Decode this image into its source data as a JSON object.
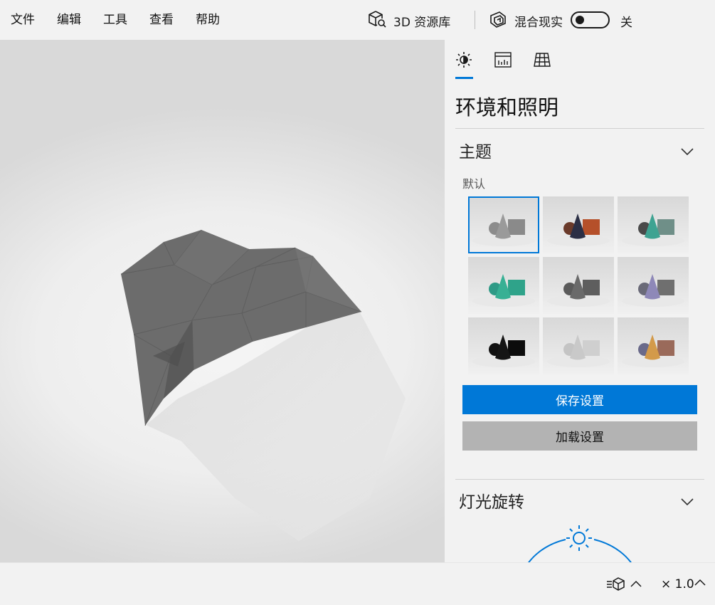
{
  "menu": {
    "items": [
      "文件",
      "编辑",
      "工具",
      "查看",
      "帮助"
    ]
  },
  "toolbar": {
    "library_label": "3D 资源库",
    "mixed_reality_label": "混合现实",
    "mixed_reality_state": "关",
    "mixed_reality_on": false
  },
  "panel": {
    "tabs": [
      {
        "icon": "sun-icon",
        "selected": true
      },
      {
        "icon": "stats-icon",
        "selected": false
      },
      {
        "icon": "grid-icon",
        "selected": false
      }
    ],
    "title": "环境和照明",
    "theme": {
      "title": "主题",
      "subtitle": "默认",
      "selected_index": 0,
      "thumbnails": [
        {
          "sphere": "#8c8c8c",
          "cone": "#9a9a9a",
          "box": "#8a8a8a"
        },
        {
          "sphere": "#6a3a2a",
          "cone": "#2b2f45",
          "box": "#b5502a"
        },
        {
          "sphere": "#4a4a4a",
          "cone": "#3ea392",
          "box": "#6f8f88"
        },
        {
          "sphere": "#2e9a86",
          "cone": "#37b094",
          "box": "#2fa38a"
        },
        {
          "sphere": "#5a5a5a",
          "cone": "#6a6a6a",
          "box": "#5e5e5e"
        },
        {
          "sphere": "#6a6a78",
          "cone": "#8e88b8",
          "box": "#6f6f6f"
        },
        {
          "sphere": "#111111",
          "cone": "#151515",
          "box": "#0c0c0c"
        },
        {
          "sphere": "#c4c4c4",
          "cone": "#c9c9c9",
          "box": "#cfcfcf"
        },
        {
          "sphere": "#6a6a8a",
          "cone": "#d39a4a",
          "box": "#9a6a5a"
        }
      ]
    },
    "save_label": "保存设置",
    "load_label": "加载设置",
    "light_rotation": {
      "title": "灯光旋转"
    }
  },
  "status": {
    "speed_label": "× 1.0"
  },
  "colors": {
    "accent": "#0078d7",
    "background": "#f2f2f2",
    "load_button": "#b3b3b3"
  }
}
